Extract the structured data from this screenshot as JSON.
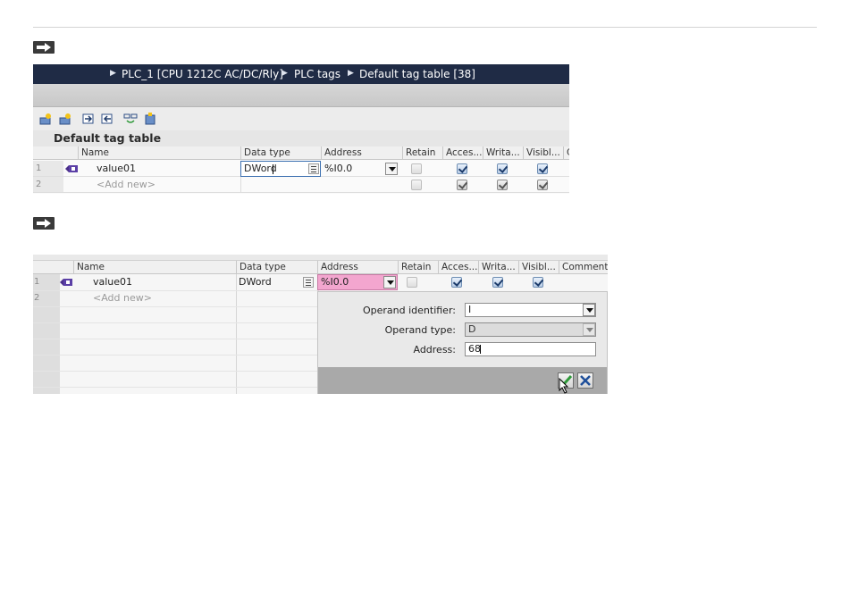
{
  "step_markers": {
    "icon": "arrow-right-icon"
  },
  "screenshot1": {
    "breadcrumb": {
      "items": [
        "PLC_1 [CPU 1212C AC/DC/Rly]",
        "PLC tags",
        "Default tag table [38]"
      ],
      "separator_icon": "triangle-right-icon"
    },
    "toolbar": {
      "icons": [
        "add-tag-icon",
        "insert-row-icon",
        "export-icon",
        "import-icon",
        "monitor-icon",
        "settings-icon"
      ]
    },
    "table_title": "Default tag table",
    "columns": [
      "Name",
      "Data type",
      "Address",
      "Retain",
      "Acces...",
      "Writa...",
      "Visibl...",
      "C"
    ],
    "rows": [
      {
        "num": "1",
        "name": "value01",
        "data_type": "DWord",
        "address": "%I0.0",
        "retain": false,
        "accessible": true,
        "writable": true,
        "visible": true
      },
      {
        "num": "2",
        "name": "<Add new>",
        "retain": false,
        "accessible": true,
        "writable": true,
        "visible": true
      }
    ]
  },
  "screenshot2": {
    "columns": [
      "Name",
      "Data type",
      "Address",
      "Retain",
      "Acces...",
      "Writa...",
      "Visibl...",
      "Comment"
    ],
    "rows": [
      {
        "num": "1",
        "name": "value01",
        "data_type": "DWord",
        "address": "%I0.0",
        "retain": false,
        "accessible": true,
        "writable": true,
        "visible": true
      },
      {
        "num": "2",
        "name": "<Add new>"
      }
    ],
    "address_popup": {
      "operand_identifier_label": "Operand identifier:",
      "operand_identifier_value": "I",
      "operand_type_label": "Operand type:",
      "operand_type_value": "D",
      "address_label": "Address:",
      "address_value": "68"
    }
  },
  "colors": {
    "breadcrumb_bg": "#1f2b45",
    "address_highlight": "#f3a6cf",
    "ok_green": "#2f9a3a",
    "cancel_blue": "#1f4f9a"
  }
}
